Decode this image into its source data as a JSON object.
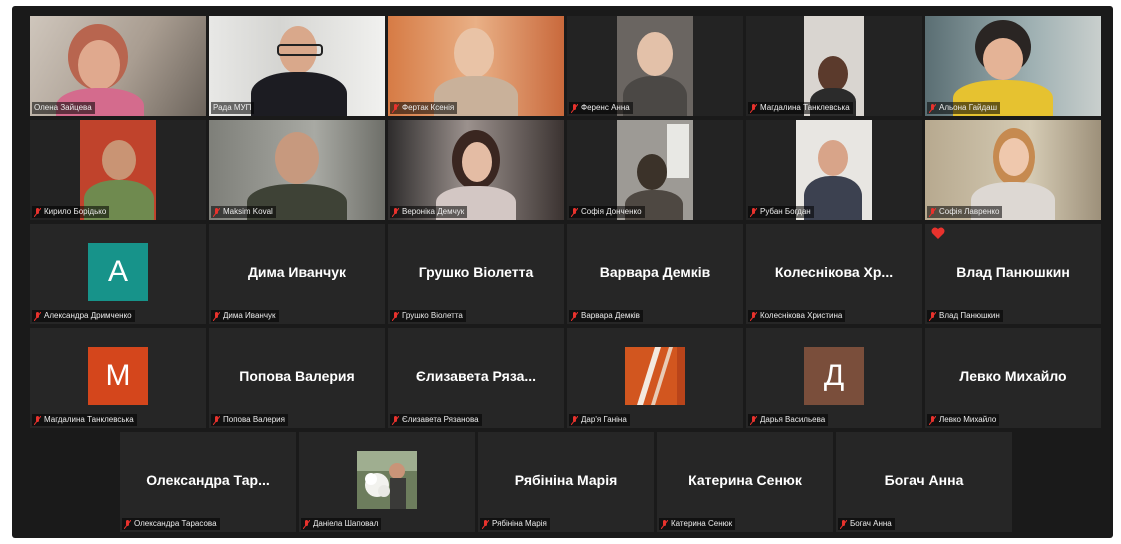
{
  "colors": {
    "background": "#1a1a1a",
    "tile": "#262626",
    "active_speaker_border": "#c9d63c",
    "muted_mic": "#e8322d"
  },
  "video_participants": [
    {
      "name": "Олена Зайцева",
      "muted": false,
      "active": false
    },
    {
      "name": "Рада МУП",
      "muted": false,
      "active": true
    },
    {
      "name": "Фертак Ксенія",
      "muted": true,
      "active": false
    },
    {
      "name": "Ференс Анна",
      "muted": true,
      "active": false
    },
    {
      "name": "Магдалина Танклевська",
      "muted": true,
      "active": false
    },
    {
      "name": "Альона Гайдаш",
      "muted": true,
      "active": false
    },
    {
      "name": "Кирило Борідько",
      "muted": true,
      "active": false
    },
    {
      "name": "Maksim Koval",
      "muted": true,
      "active": false
    },
    {
      "name": "Вероніка Демчук",
      "muted": true,
      "active": false
    },
    {
      "name": "Софія Донченко",
      "muted": true,
      "active": false
    },
    {
      "name": "Рубан Богдан",
      "muted": true,
      "active": false
    },
    {
      "name": "Софія Лавренко",
      "muted": true,
      "active": false
    }
  ],
  "name_participants": [
    {
      "tile_type": "avatar-letter",
      "avatar_letter": "A",
      "avatar_color": "#17938a",
      "nameplate": "Александра Дримченко",
      "muted": true
    },
    {
      "tile_type": "name",
      "display_name": "Дима Иванчук",
      "nameplate": "Дима Иванчук",
      "muted": true
    },
    {
      "tile_type": "name",
      "display_name": "Грушко Віолетта",
      "nameplate": "Грушко Віолетта",
      "muted": true
    },
    {
      "tile_type": "name",
      "display_name": "Варвара Демків",
      "nameplate": "Варвара Демків",
      "muted": true
    },
    {
      "tile_type": "name",
      "display_name": "Колеснікова Хр...",
      "nameplate": "Колеснікова Христина",
      "muted": true
    },
    {
      "tile_type": "name",
      "display_name": "Влад Панюшкин",
      "nameplate": "Влад Панюшкин",
      "muted": true,
      "reaction": "heart"
    },
    {
      "tile_type": "avatar-letter",
      "avatar_letter": "M",
      "avatar_color": "#d4461c",
      "nameplate": "Магдалина Танклевська",
      "muted": true
    },
    {
      "tile_type": "name",
      "display_name": "Попова Валерия",
      "nameplate": "Попова Валерия",
      "muted": true
    },
    {
      "tile_type": "name",
      "display_name": "Єлизавета Ряза...",
      "nameplate": "Єлизавета Рязанова",
      "muted": true
    },
    {
      "tile_type": "avatar-image",
      "avatar_image": "orange-stripes-picture",
      "nameplate": "Дар'я Ганіна",
      "muted": true
    },
    {
      "tile_type": "avatar-letter",
      "avatar_letter": "Д",
      "avatar_color": "#7a4e3b",
      "nameplate": "Дарья Васильева",
      "muted": true
    },
    {
      "tile_type": "name",
      "display_name": "Левко Михайло",
      "nameplate": "Левко Михайло",
      "muted": true
    },
    {
      "tile_type": "name",
      "display_name": "Олександра Тар...",
      "nameplate": "Олександра Тарасова",
      "muted": true
    },
    {
      "tile_type": "avatar-image",
      "avatar_image": "girl-with-flowers-photo",
      "nameplate": "Даніела Шаповал",
      "muted": true
    },
    {
      "tile_type": "name",
      "display_name": "Рябініна Марія",
      "nameplate": "Рябініна Марія",
      "muted": true
    },
    {
      "tile_type": "name",
      "display_name": "Катерина Сенюк",
      "nameplate": "Катерина Сенюк",
      "muted": true
    },
    {
      "tile_type": "name",
      "display_name": "Богач Анна",
      "nameplate": "Богач Анна",
      "muted": true
    }
  ]
}
